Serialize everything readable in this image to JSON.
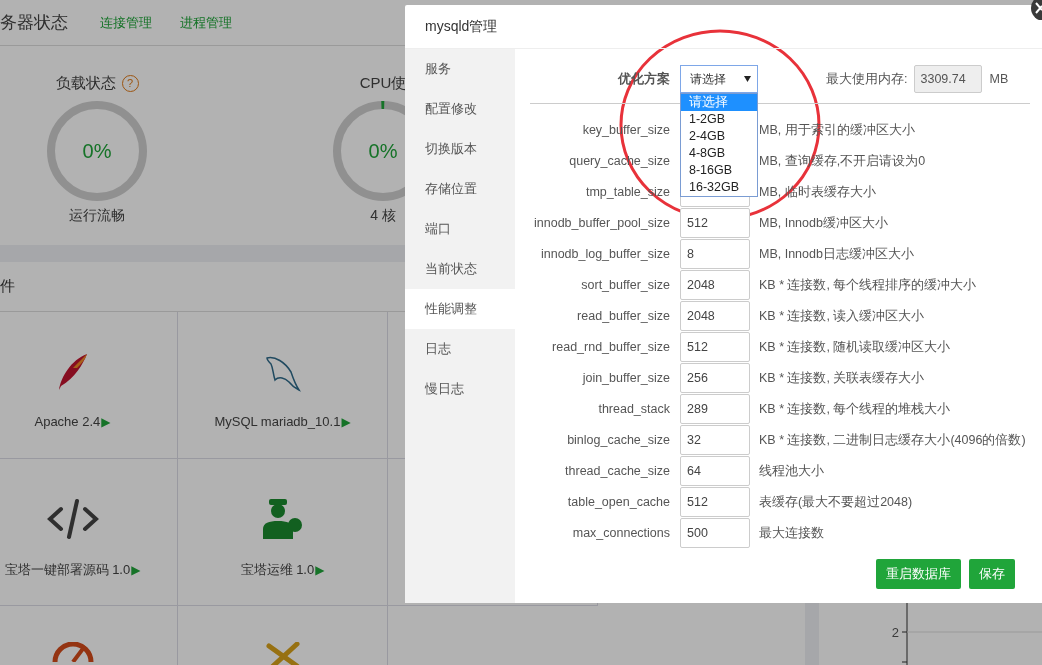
{
  "page_header": {
    "title": "务器状态",
    "links": [
      "连接管理",
      "进程管理"
    ]
  },
  "gauges": [
    {
      "title": "负载状态",
      "help": "?",
      "value": "0%",
      "level": 0,
      "caption": "运行流畅"
    },
    {
      "title": "CPU使",
      "value": "0%",
      "level": 0.01,
      "caption": "4 核"
    }
  ],
  "software": {
    "title": "件",
    "items": [
      {
        "name": "Apache 2.4",
        "arrow": "▶"
      },
      {
        "name": "MySQL mariadb_10.1",
        "arrow": "▶"
      },
      {
        "name": "宝塔一键部署源码 1.0",
        "arrow": "▶"
      },
      {
        "name": "宝塔运维 1.0",
        "arrow": "▶"
      }
    ]
  },
  "chart": {
    "tick_labels": [
      "2"
    ]
  },
  "dialog": {
    "title": "mysqld管理",
    "menu": [
      {
        "label": "服务",
        "selected": false
      },
      {
        "label": "配置修改",
        "selected": false
      },
      {
        "label": "切换版本",
        "selected": false
      },
      {
        "label": "存储位置",
        "selected": false
      },
      {
        "label": "端口",
        "selected": false
      },
      {
        "label": "当前状态",
        "selected": false
      },
      {
        "label": "性能调整",
        "selected": true
      },
      {
        "label": "日志",
        "selected": false
      },
      {
        "label": "慢日志",
        "selected": false
      }
    ],
    "plan": {
      "label": "优化方案",
      "value": "请选择",
      "options": [
        {
          "label": "请选择",
          "selected": true
        },
        {
          "label": "1-2GB",
          "selected": false
        },
        {
          "label": "2-4GB",
          "selected": false
        },
        {
          "label": "4-8GB",
          "selected": false
        },
        {
          "label": "8-16GB",
          "selected": false
        },
        {
          "label": "16-32GB",
          "selected": false
        }
      ]
    },
    "memory": {
      "label": "最大使用内存:",
      "value": "3309.74",
      "unit": "MB"
    },
    "params": [
      {
        "name": "key_buffer_size",
        "note": "MB, 用于索引的缓冲区大小"
      },
      {
        "name": "query_cache_size",
        "note": "MB, 查询缓存,不开启请设为0"
      },
      {
        "name": "tmp_table_size",
        "note": "MB, 临时表缓存大小"
      },
      {
        "name": "innodb_buffer_pool_size",
        "value": "512",
        "note": "MB, Innodb缓冲区大小"
      },
      {
        "name": "innodb_log_buffer_size",
        "value": "8",
        "note": "MB, Innodb日志缓冲区大小"
      },
      {
        "name": "sort_buffer_size",
        "value": "2048",
        "note": "KB * 连接数, 每个线程排序的缓冲大小"
      },
      {
        "name": "read_buffer_size",
        "value": "2048",
        "note": "KB * 连接数, 读入缓冲区大小"
      },
      {
        "name": "read_rnd_buffer_size",
        "value": "512",
        "note": "KB * 连接数, 随机读取缓冲区大小"
      },
      {
        "name": "join_buffer_size",
        "value": "256",
        "note": "KB * 连接数, 关联表缓存大小"
      },
      {
        "name": "thread_stack",
        "value": "289",
        "note": "KB * 连接数, 每个线程的堆栈大小"
      },
      {
        "name": "binlog_cache_size",
        "value": "32",
        "note": "KB * 连接数, 二进制日志缓存大小(4096的倍数)"
      },
      {
        "name": "thread_cache_size",
        "value": "64",
        "note": "线程池大小"
      },
      {
        "name": "table_open_cache",
        "value": "512",
        "note": "表缓存(最大不要超过2048)"
      },
      {
        "name": "max_connections",
        "value": "500",
        "note": "最大连接数"
      }
    ],
    "buttons": [
      "重启数据库",
      "保存"
    ]
  }
}
